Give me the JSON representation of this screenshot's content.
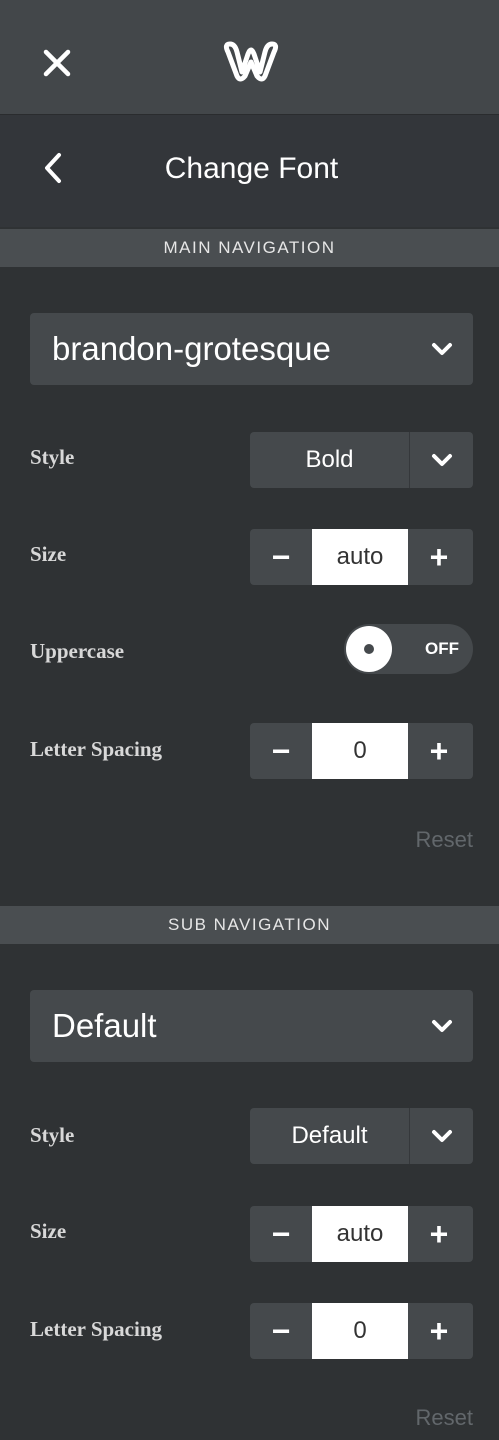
{
  "topbar": {
    "close_icon": "close-icon",
    "logo_icon": "weebly-logo-icon"
  },
  "header": {
    "title": "Change Font",
    "back_icon": "chevron-left-icon"
  },
  "main_navigation": {
    "section_title": "MAIN NAVIGATION",
    "font": "brandon-grotesque",
    "style_label": "Style",
    "style_value": "Bold",
    "size_label": "Size",
    "size_value": "auto",
    "uppercase_label": "Uppercase",
    "uppercase_state": "OFF",
    "letter_spacing_label": "Letter Spacing",
    "letter_spacing_value": "0",
    "reset_label": "Reset"
  },
  "sub_navigation": {
    "section_title": "SUB NAVIGATION",
    "font": "Default",
    "style_label": "Style",
    "style_value": "Default",
    "size_label": "Size",
    "size_value": "auto",
    "letter_spacing_label": "Letter Spacing",
    "letter_spacing_value": "0",
    "reset_label": "Reset"
  },
  "stepper": {
    "minus": "−",
    "plus": "+"
  },
  "colors": {
    "background": "#2f3234",
    "topbar": "#43474a",
    "control": "#45494c",
    "section_bar": "#4a4e51",
    "reset_text": "#62676b"
  }
}
